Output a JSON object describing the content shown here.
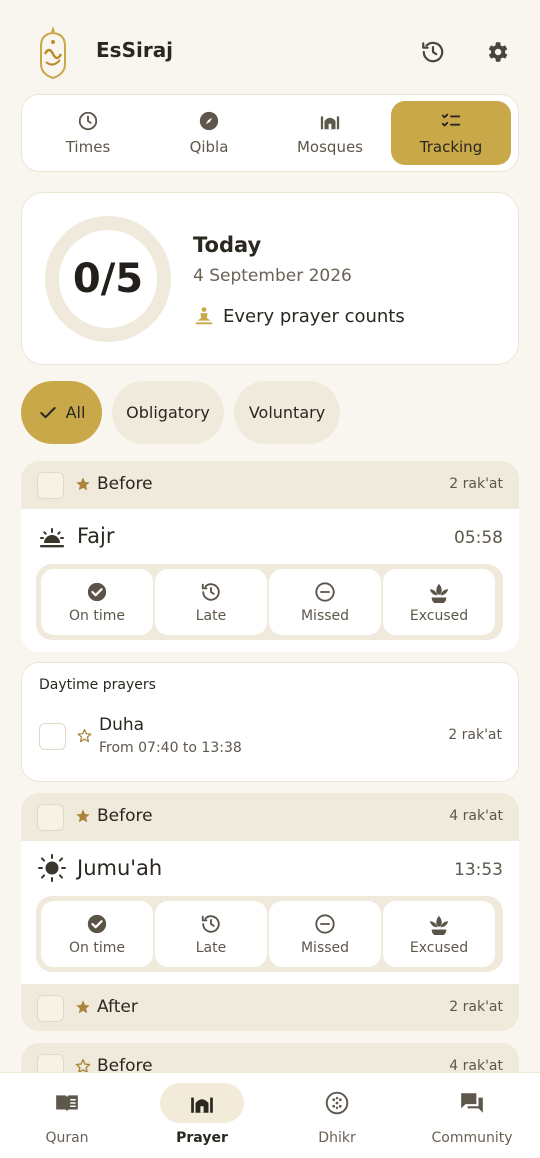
{
  "app": {
    "title": "EsSiraj"
  },
  "header": {
    "history_icon": "history-icon",
    "settings_icon": "gear-icon"
  },
  "top_tabs": [
    {
      "label": "Times",
      "icon": "clock-icon",
      "active": false
    },
    {
      "label": "Qibla",
      "icon": "compass-icon",
      "active": false
    },
    {
      "label": "Mosques",
      "icon": "mosque-icon",
      "active": false
    },
    {
      "label": "Tracking",
      "icon": "checklist-icon",
      "active": true
    }
  ],
  "summary": {
    "progress": "0/5",
    "completed": 0,
    "total": 5,
    "title": "Today",
    "date": "4 September 2026",
    "motto": "Every prayer counts"
  },
  "filters": [
    {
      "label": "All",
      "active": true
    },
    {
      "label": "Obligatory",
      "active": false
    },
    {
      "label": "Voluntary",
      "active": false
    }
  ],
  "status_labels": {
    "on_time": "On time",
    "late": "Late",
    "missed": "Missed",
    "excused": "Excused"
  },
  "prayers": {
    "fajr": {
      "before": {
        "label": "Before",
        "rakat": "2 rak'at"
      },
      "name": "Fajr",
      "time": "05:58"
    },
    "jumuah": {
      "before": {
        "label": "Before",
        "rakat": "4 rak'at"
      },
      "name": "Jumu'ah",
      "time": "13:53",
      "after": {
        "label": "After",
        "rakat": "2 rak'at"
      },
      "next": {
        "label": "Before",
        "rakat": "4 rak'at"
      }
    }
  },
  "daytime": {
    "title": "Daytime prayers",
    "name": "Duha",
    "range": "From 07:40 to 13:38",
    "rakat": "2 rak'at"
  },
  "bottom_nav": [
    {
      "label": "Quran",
      "icon": "book-icon",
      "active": false
    },
    {
      "label": "Prayer",
      "icon": "mosque-icon",
      "active": true
    },
    {
      "label": "Dhikr",
      "icon": "beads-icon",
      "active": false
    },
    {
      "label": "Community",
      "icon": "chat-icon",
      "active": false
    }
  ],
  "colors": {
    "accent": "#c9a84a",
    "background": "#f9f6ef",
    "muted": "#efeadb"
  }
}
